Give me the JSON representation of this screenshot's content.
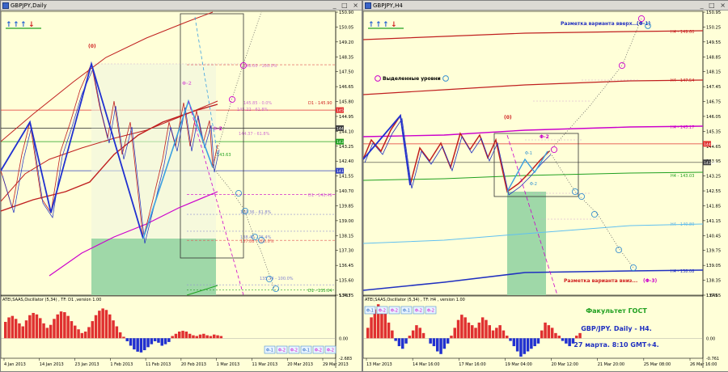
{
  "left": {
    "title": "GBPJPY,Daily",
    "price_scale": [
      "150.90",
      "150.05",
      "149.20",
      "148.35",
      "147.50",
      "146.65",
      "145.80",
      "144.95",
      "144.10",
      "143.25",
      "142.40",
      "141.55",
      "140.70",
      "139.85",
      "139.00",
      "138.15",
      "137.30",
      "136.45",
      "135.60",
      "134.75"
    ],
    "price_tags": [
      {
        "text": "145.31",
        "color": "#e03030",
        "price": 145.31
      },
      {
        "text": "144.28",
        "color": "#404040",
        "price": 144.28
      },
      {
        "text": "143.51",
        "color": "#20a020",
        "price": 143.51
      },
      {
        "text": "141.85",
        "color": "#3040c0",
        "price": 141.85
      }
    ],
    "level_labels": [
      {
        "text": "(0)",
        "price": 149.35,
        "color": "#d02020",
        "bold": true
      },
      {
        "text": "Φ-2",
        "price": 146.5,
        "color": "#cc00cc",
        "bold": true
      },
      {
        "text": "Φ-2",
        "price": 144.7,
        "color": "#cc00cc",
        "bold": true
      },
      {
        "text": "Φ-1",
        "price": 136.5,
        "color": "#cc00cc",
        "bold": true
      },
      {
        "text": "148.00 - 100.0%",
        "price": 148.0,
        "color": "#d070d0",
        "bold": false
      },
      {
        "text": "145.85 - 0.0%",
        "price": 145.85,
        "color": "#d070d0",
        "bold": false
      },
      {
        "text": "D1 - 145.90",
        "price": 145.9,
        "color": "#d02020",
        "bold": false
      },
      {
        "text": "145.22 - 61.8%",
        "price": 145.22,
        "color": "#d070d0",
        "bold": false
      },
      {
        "text": "144.37 - 61.8%",
        "price": 144.37,
        "color": "#d070d0",
        "bold": false
      },
      {
        "text": "143.63",
        "price": 143.6,
        "color": "#20a020",
        "bold": false
      },
      {
        "text": "D1 - 140.49",
        "price": 140.49,
        "color": "#d070d0",
        "bold": false
      },
      {
        "text": "139.36 - 61.8%",
        "price": 139.36,
        "color": "#8080d0",
        "bold": false
      },
      {
        "text": "138.40 - 76.4%",
        "price": 138.4,
        "color": "#8080d0",
        "bold": false
      },
      {
        "text": "137.88 - 100.0%",
        "price": 137.88,
        "color": "#e05050",
        "bold": false
      },
      {
        "text": "135.34 - 100.0%",
        "price": 135.34,
        "color": "#8080d0",
        "bold": false
      },
      {
        "text": "D1 - 135.04",
        "price": 135.04,
        "color": "#20a020",
        "bold": false
      }
    ],
    "dates": [
      "4 Jan 2013",
      "14 Jan 2013",
      "23 Jan 2013",
      "1 Feb 2013",
      "11 Feb 2013",
      "20 Feb 2013",
      "1 Mar 2013",
      "11 Mar 2013",
      "20 Mar 2013",
      "29 Mar 2013"
    ],
    "osc_label": "ATEI,SAAS,Oscillator (5,34) , TF: D1 ,version 1.00",
    "osc_scale": [
      "5.783",
      "0.00",
      "-2.683"
    ],
    "phi_buttons": [
      "Φ-1",
      "Φ-2",
      "Φ-2",
      "Φ-1",
      "Φ-2",
      "Φ-2"
    ]
  },
  "right": {
    "title": "GBPJPY,H4",
    "price_scale": [
      "150.95",
      "150.25",
      "149.55",
      "148.85",
      "148.15",
      "147.45",
      "146.75",
      "146.05",
      "145.35",
      "144.65",
      "143.95",
      "143.25",
      "142.55",
      "141.85",
      "141.15",
      "140.45",
      "139.75",
      "139.05",
      "138.35",
      "137.65"
    ],
    "price_tags": [
      {
        "text": "144.76",
        "color": "#e03030",
        "price": 144.76
      },
      {
        "text": "143.89",
        "color": "#404040",
        "price": 143.89
      }
    ],
    "level_labels": [
      {
        "text": "Разметка варианта вверх...",
        "price": 150.1,
        "color": "#2030c0",
        "bold": true
      },
      {
        "text": "(Φ-1)",
        "price": 150.1,
        "color": "#2030c0",
        "bold": true
      },
      {
        "text": "Выделенные уровни",
        "price": 147.4,
        "color": "#000000",
        "bold": true
      },
      {
        "text": "H4 - 149.60",
        "price": 149.6,
        "color": "#d02020",
        "bold": false
      },
      {
        "text": "H4 - 147.54",
        "price": 147.54,
        "color": "#d02020",
        "bold": false
      },
      {
        "text": "H4 - 145.17",
        "price": 145.17,
        "color": "#cc00cc",
        "bold": false
      },
      {
        "text": "H4 - 143.03",
        "price": 143.03,
        "color": "#20a020",
        "bold": false
      },
      {
        "text": "H4 - 140.80",
        "price": 140.8,
        "color": "#60b0e0",
        "bold": false
      },
      {
        "text": "H4 - 138.08",
        "price": 138.08,
        "color": "#2030c0",
        "bold": false
      },
      {
        "text": "(0)",
        "price": 145.9,
        "color": "#d02020",
        "bold": true
      },
      {
        "text": "Φ-2",
        "price": 144.7,
        "color": "#cc00cc",
        "bold": true
      },
      {
        "text": "Φ-1",
        "price": 144.0,
        "color": "#3090d0",
        "bold": false
      },
      {
        "text": "Φ-2",
        "price": 142.5,
        "color": "#3090d0",
        "bold": false
      },
      {
        "text": "(0)",
        "price": 141.7,
        "color": "#2030c0",
        "bold": true
      },
      {
        "text": "Φ-1",
        "price": 141.2,
        "color": "#cc00cc",
        "bold": true
      },
      {
        "text": "Разметка варианта вниз...",
        "price": 137.6,
        "color": "#d02020",
        "bold": true
      },
      {
        "text": "(Φ-3)",
        "price": 137.6,
        "color": "#cc00cc",
        "bold": true
      }
    ],
    "dates": [
      "13 Mar 2013",
      "14 Mar 16:00",
      "17 Mar 16:00",
      "19 Mar 04:00",
      "20 Mar 12:00",
      "21 Mar 20:00",
      "25 Mar 08:00",
      "26 Mar 16:00"
    ],
    "osc_label": "ATEI,SAAS,Oscillator (5,34) , TF: H4 , version 1.00",
    "osc_scale": [
      "1.645",
      "0.00",
      "-0.761"
    ],
    "phi_buttons": [
      "Φ-1",
      "Φ-2",
      "Φ-2",
      "Φ-1",
      "Φ-2",
      "Φ-2"
    ],
    "note": [
      "Факультет ГОСТ",
      "GBP/JPY. Daily - H4.",
      "27 марта. 8:10 GMT+4."
    ]
  }
}
